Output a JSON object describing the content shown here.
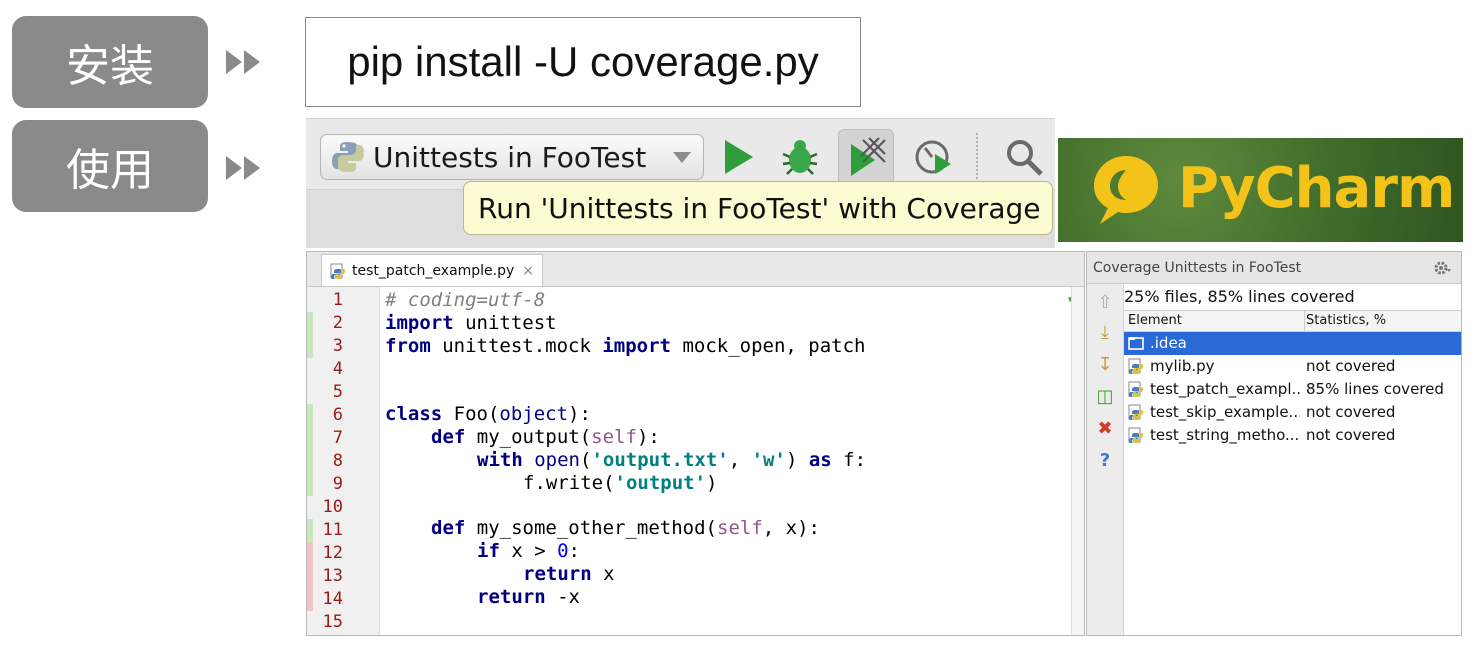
{
  "labels": {
    "install": "安装",
    "usage": "使用"
  },
  "command": "pip install -U coverage.py",
  "toolbar": {
    "run_config_label": "Unittests in FooTest",
    "tooltip": "Run 'Unittests in FooTest' with Coverage",
    "icons": [
      "python-icon",
      "run-icon",
      "debug-icon",
      "coverage-icon",
      "profile-icon",
      "search-icon"
    ]
  },
  "banner": {
    "text": "PyCharm"
  },
  "editor": {
    "tab_name": "test_patch_example.py",
    "tab_close": "×",
    "lines": [
      {
        "n": "1",
        "cov": "none"
      },
      {
        "n": "2",
        "cov": "green"
      },
      {
        "n": "3",
        "cov": "green"
      },
      {
        "n": "4",
        "cov": "none"
      },
      {
        "n": "5",
        "cov": "none"
      },
      {
        "n": "6",
        "cov": "green"
      },
      {
        "n": "7",
        "cov": "green"
      },
      {
        "n": "8",
        "cov": "green"
      },
      {
        "n": "9",
        "cov": "green"
      },
      {
        "n": "10",
        "cov": "none"
      },
      {
        "n": "11",
        "cov": "green"
      },
      {
        "n": "12",
        "cov": "red"
      },
      {
        "n": "13",
        "cov": "red"
      },
      {
        "n": "14",
        "cov": "red"
      },
      {
        "n": "15",
        "cov": "none"
      }
    ],
    "code": {
      "l1_comment": "# coding=utf-8",
      "l2_import": "import",
      "l2_mod": " unittest",
      "l3_from": "from",
      "l3_mod": " unittest.mock ",
      "l3_import": "import",
      "l3_names": " mock_open, patch",
      "l6_class": "class",
      "l6_name": " Foo(",
      "l6_base": "object",
      "l6_end": "):",
      "l7_def": "def",
      "l7_name": " my_output(",
      "l7_self": "self",
      "l7_end": "):",
      "l8_with": "with",
      "l8_sp": " ",
      "l8_open": "open",
      "l8_p1": "(",
      "l8_s1": "'output.txt'",
      "l8_c": ", ",
      "l8_s2": "'w'",
      "l8_p2": ") ",
      "l8_as": "as",
      "l8_f": " f:",
      "l9_call": "f.write(",
      "l9_s": "'output'",
      "l9_end": ")",
      "l11_def": "def",
      "l11_name": " my_some_other_method(",
      "l11_self": "self",
      "l11_end": ", x):",
      "l12_if": "if",
      "l12_cond": " x > ",
      "l12_num": "0",
      "l12_end": ":",
      "l13_ret": "return",
      "l13_x": " x",
      "l14_ret": "return",
      "l14_x": " -x"
    }
  },
  "coverage_panel": {
    "title": "Coverage Unittests in FooTest",
    "summary": "25% files, 85% lines covered",
    "col_element": "Element",
    "col_stats": "Statistics, %",
    "rows": [
      {
        "name": ".idea",
        "stat": "",
        "kind": "folder",
        "selected": true
      },
      {
        "name": "mylib.py",
        "stat": "not covered",
        "kind": "python",
        "selected": false
      },
      {
        "name": "test_patch_exampl...",
        "stat": "85% lines covered",
        "kind": "python",
        "selected": false
      },
      {
        "name": "test_skip_example...",
        "stat": "not covered",
        "kind": "python",
        "selected": false
      },
      {
        "name": "test_string_metho...",
        "stat": "not covered",
        "kind": "python",
        "selected": false
      }
    ]
  },
  "colors": {
    "pill": "#8a8a8a",
    "run_green": "#2f9e3a",
    "selection": "#2a6ad6",
    "banner_text": "#f4c31a",
    "covered": "#c8e8c0",
    "uncovered": "#f3c2c2"
  }
}
